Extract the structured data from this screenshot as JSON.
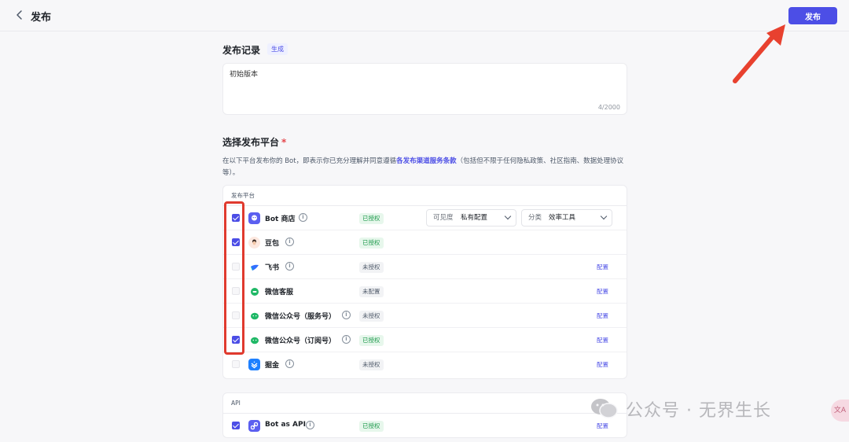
{
  "header": {
    "title": "发布",
    "publish_label": "发布"
  },
  "record": {
    "title": "发布记录",
    "generate_label": "生成",
    "text": "初始版本",
    "count": "4/2000"
  },
  "platform_section": {
    "title": "选择发布平台",
    "required_mark": "*",
    "desc_prefix": "在以下平台发布你的 Bot，即表示你已充分理解并同意遵循",
    "desc_link": "各发布渠道服务条款",
    "desc_suffix": "（包括但不限于任何隐私政策、社区指南、数据处理协议等）。"
  },
  "platforms_card": {
    "header": "发布平台",
    "visibility_label": "可见度",
    "visibility_value": "私有配置",
    "category_label": "分类",
    "category_value": "效率工具",
    "items": [
      {
        "name": "Bot 商店",
        "status": "已授权",
        "checked": true,
        "config": ""
      },
      {
        "name": "豆包",
        "status": "已授权",
        "checked": true,
        "config": ""
      },
      {
        "name": "飞书",
        "status": "未授权",
        "checked": false,
        "config": "配置"
      },
      {
        "name": "微信客服",
        "status": "未配置",
        "checked": false,
        "config": "配置"
      },
      {
        "name": "微信公众号（服务号）",
        "status": "未授权",
        "checked": false,
        "config": "配置"
      },
      {
        "name": "微信公众号（订阅号）",
        "status": "已授权",
        "checked": true,
        "config": "配置"
      },
      {
        "name": "掘金",
        "status": "未授权",
        "checked": false,
        "config": "配置"
      }
    ]
  },
  "api_card": {
    "header": "API",
    "items": [
      {
        "name": "Bot as API",
        "status": "已授权",
        "checked": true,
        "config": "配置"
      }
    ]
  },
  "watermark": {
    "text": "公众号 · 无界生长"
  },
  "colors": {
    "accent": "#4c4ee6",
    "highlight_red": "#e03a2e",
    "ok_green": "#1f9a4d"
  },
  "icons": {
    "back": "chevron-left-icon",
    "info": "info-circle-icon",
    "dropdown": "chevron-down-icon"
  }
}
